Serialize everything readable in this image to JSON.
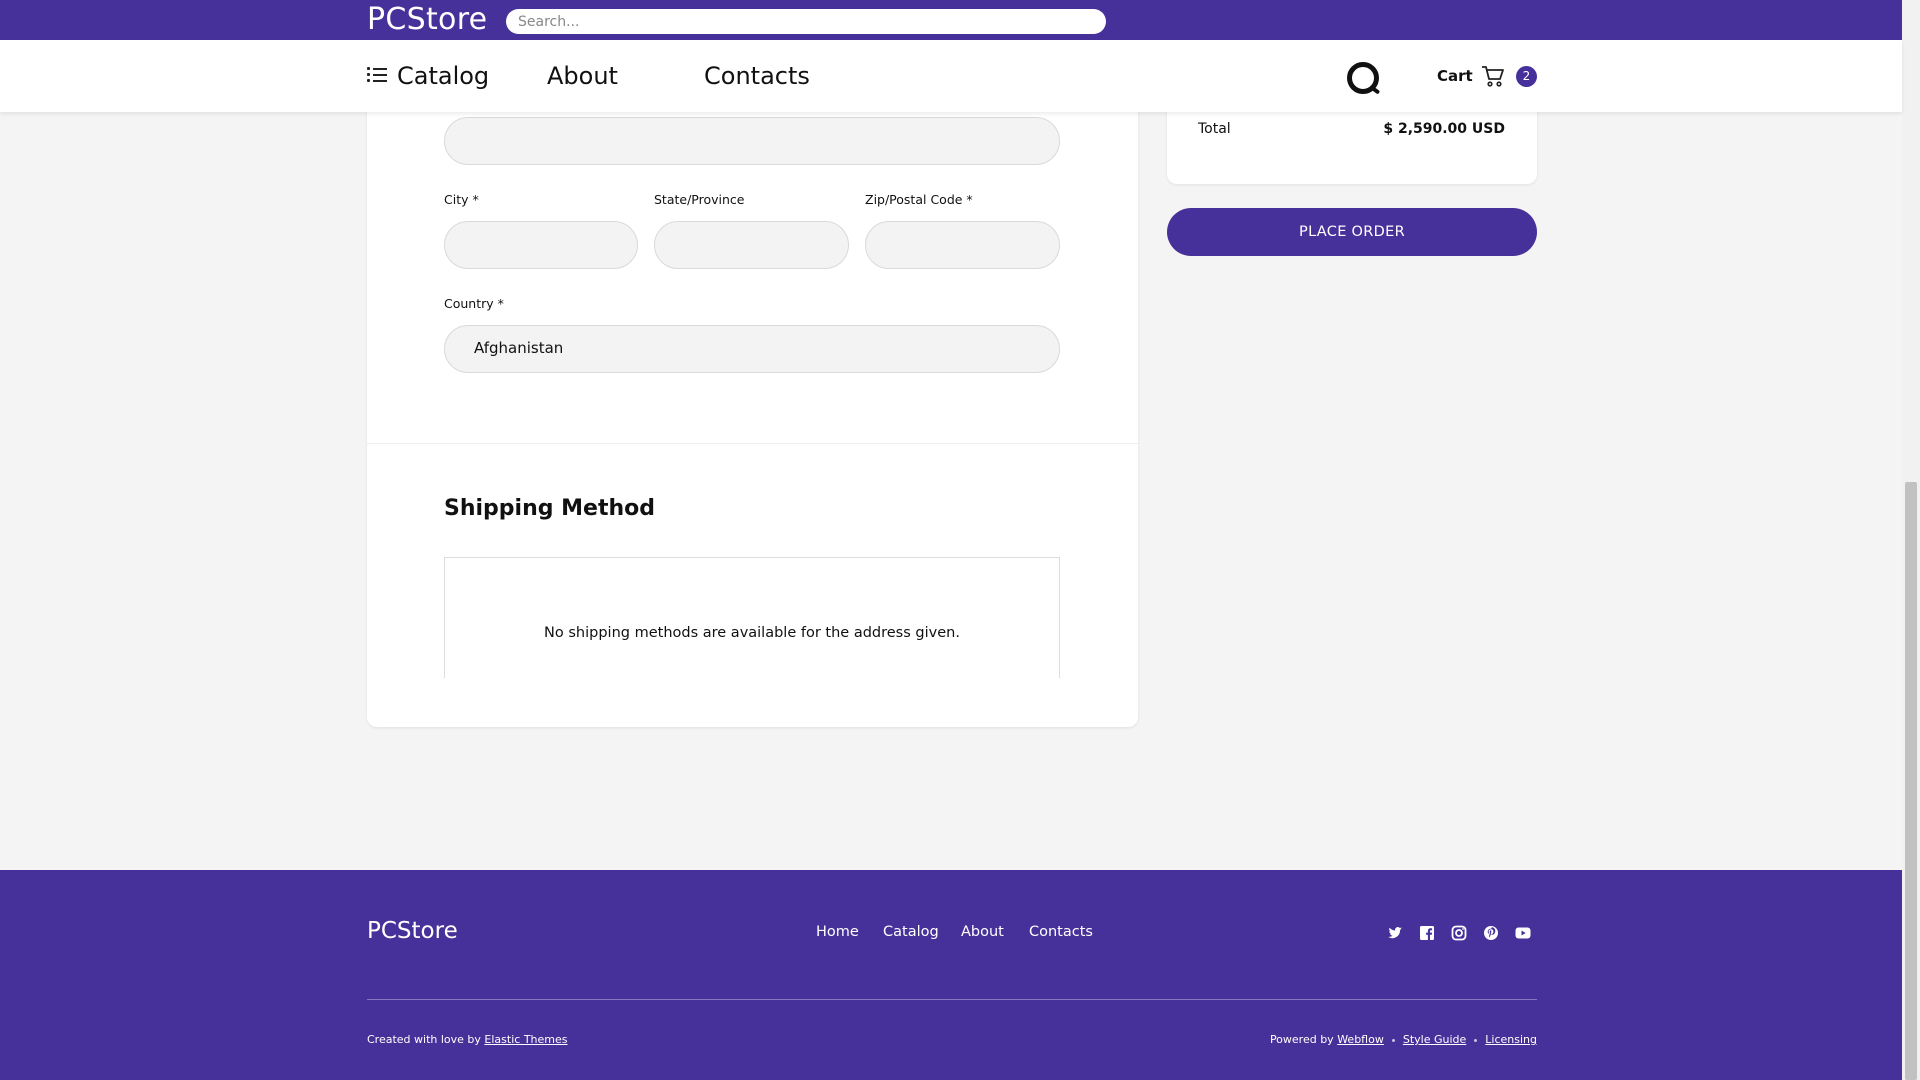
{
  "header": {
    "logo": "PCStore",
    "search_placeholder": "Search..."
  },
  "nav": {
    "items": [
      "Catalog",
      "About",
      "Contacts"
    ],
    "cart_label": "Cart",
    "cart_count": "2",
    "icons": [
      "list-icon",
      "search-icon",
      "cart-icon"
    ]
  },
  "form": {
    "city_label": "City *",
    "state_label": "State/Province",
    "zip_label": "Zip/Postal Code *",
    "country_label": "Country *",
    "country_value": "Afghanistan"
  },
  "shipping": {
    "title": "Shipping Method",
    "message": "No shipping methods are available for the address given."
  },
  "summary": {
    "total_label": "Total",
    "total_value": "$ 2,590.00 USD",
    "place_order": "PLACE ORDER"
  },
  "footer": {
    "logo": "PCStore",
    "links": [
      "Home",
      "Catalog",
      "About",
      "Contacts"
    ],
    "social_icons": [
      "twitter-icon",
      "facebook-icon",
      "instagram-icon",
      "pinterest-icon",
      "youtube-icon"
    ],
    "credit_prefix": "Created with love by",
    "credit_link": "Elastic Themes",
    "powered_prefix": "Powered by",
    "powered_link": "Webflow",
    "style_guide": "Style Guide",
    "licensing": "Licensing"
  },
  "colors": {
    "brand": "#46319a",
    "background": "#f4f4f4"
  }
}
